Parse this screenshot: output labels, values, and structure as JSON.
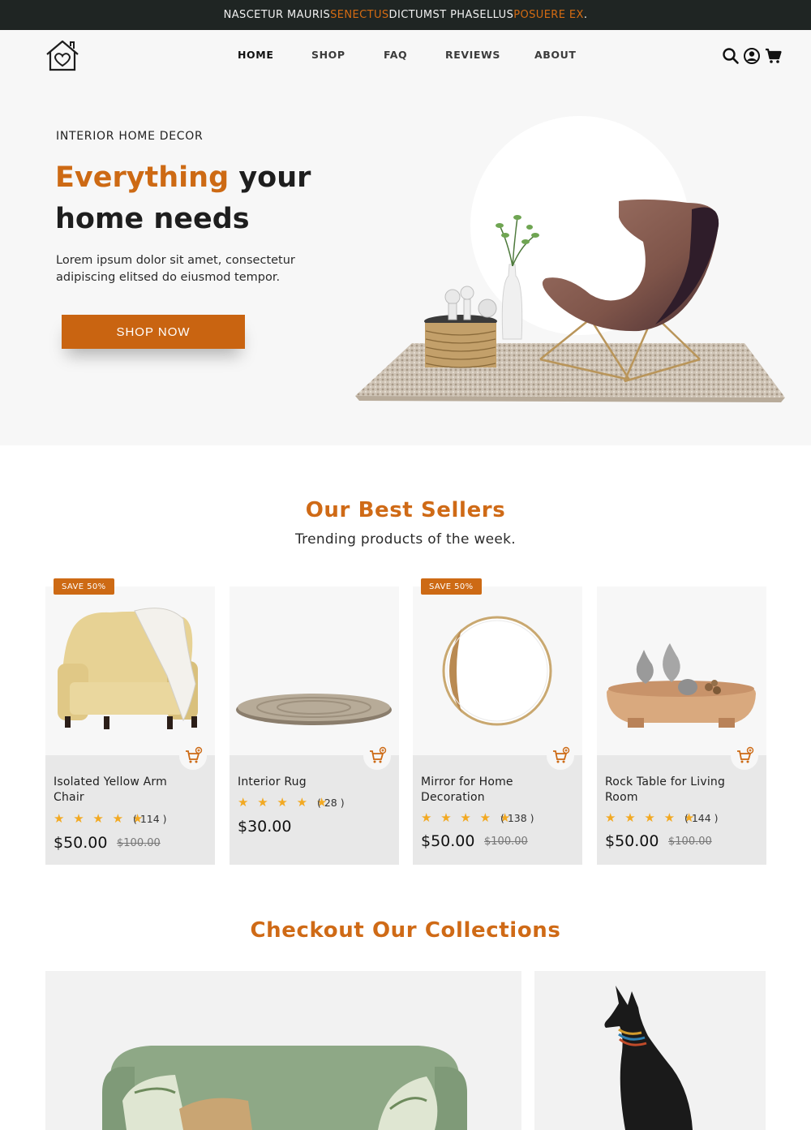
{
  "announcement": {
    "part1": "NASCETUR MAURIS ",
    "accent1": "SENECTUS",
    "part2": " DICTUMST PHASELLUS ",
    "accent2": "POSUERE EX",
    "part3": "."
  },
  "nav": {
    "items": [
      {
        "label": "HOME",
        "active": true
      },
      {
        "label": "SHOP"
      },
      {
        "label": "FAQ"
      },
      {
        "label": "REVIEWS"
      },
      {
        "label": "ABOUT"
      }
    ]
  },
  "header_icons": [
    "search-icon",
    "account-icon",
    "cart-icon"
  ],
  "hero": {
    "eyebrow": "INTERIOR HOME DECOR",
    "headline_accent": "Everything",
    "headline_rest1": " your",
    "headline_rest2": "home needs",
    "description": "Lorem ipsum dolor sit amet, consectetur adipiscing elitsed do eiusmod tempor.",
    "cta": "SHOP NOW"
  },
  "best_sellers": {
    "title": "Our Best Sellers",
    "subtitle": "Trending products of the week.",
    "products": [
      {
        "badge": "SAVE 50%",
        "name": "Isolated Yellow Arm Chair",
        "stars": "★ ★ ★ ★ ★",
        "reviews": "( 114 )",
        "price": "$50.00",
        "old_price": "$100.00"
      },
      {
        "badge": "",
        "name": "Interior Rug",
        "stars": "★ ★ ★ ★ ★",
        "reviews": "( 28 )",
        "price": "$30.00",
        "old_price": ""
      },
      {
        "badge": "SAVE 50%",
        "name": "Mirror for Home Decoration",
        "stars": "★ ★ ★ ★ ★",
        "reviews": "( 138 )",
        "price": "$50.00",
        "old_price": "$100.00"
      },
      {
        "badge": "",
        "name": "Rock Table for Living Room",
        "stars": "★ ★ ★ ★ ★",
        "reviews": "( 144 )",
        "price": "$50.00",
        "old_price": "$100.00"
      }
    ]
  },
  "collections": {
    "title": "Checkout Our Collections"
  },
  "colors": {
    "accent": "#cd6a14",
    "announcement_bg": "#1f2523",
    "star": "#f2a922"
  }
}
